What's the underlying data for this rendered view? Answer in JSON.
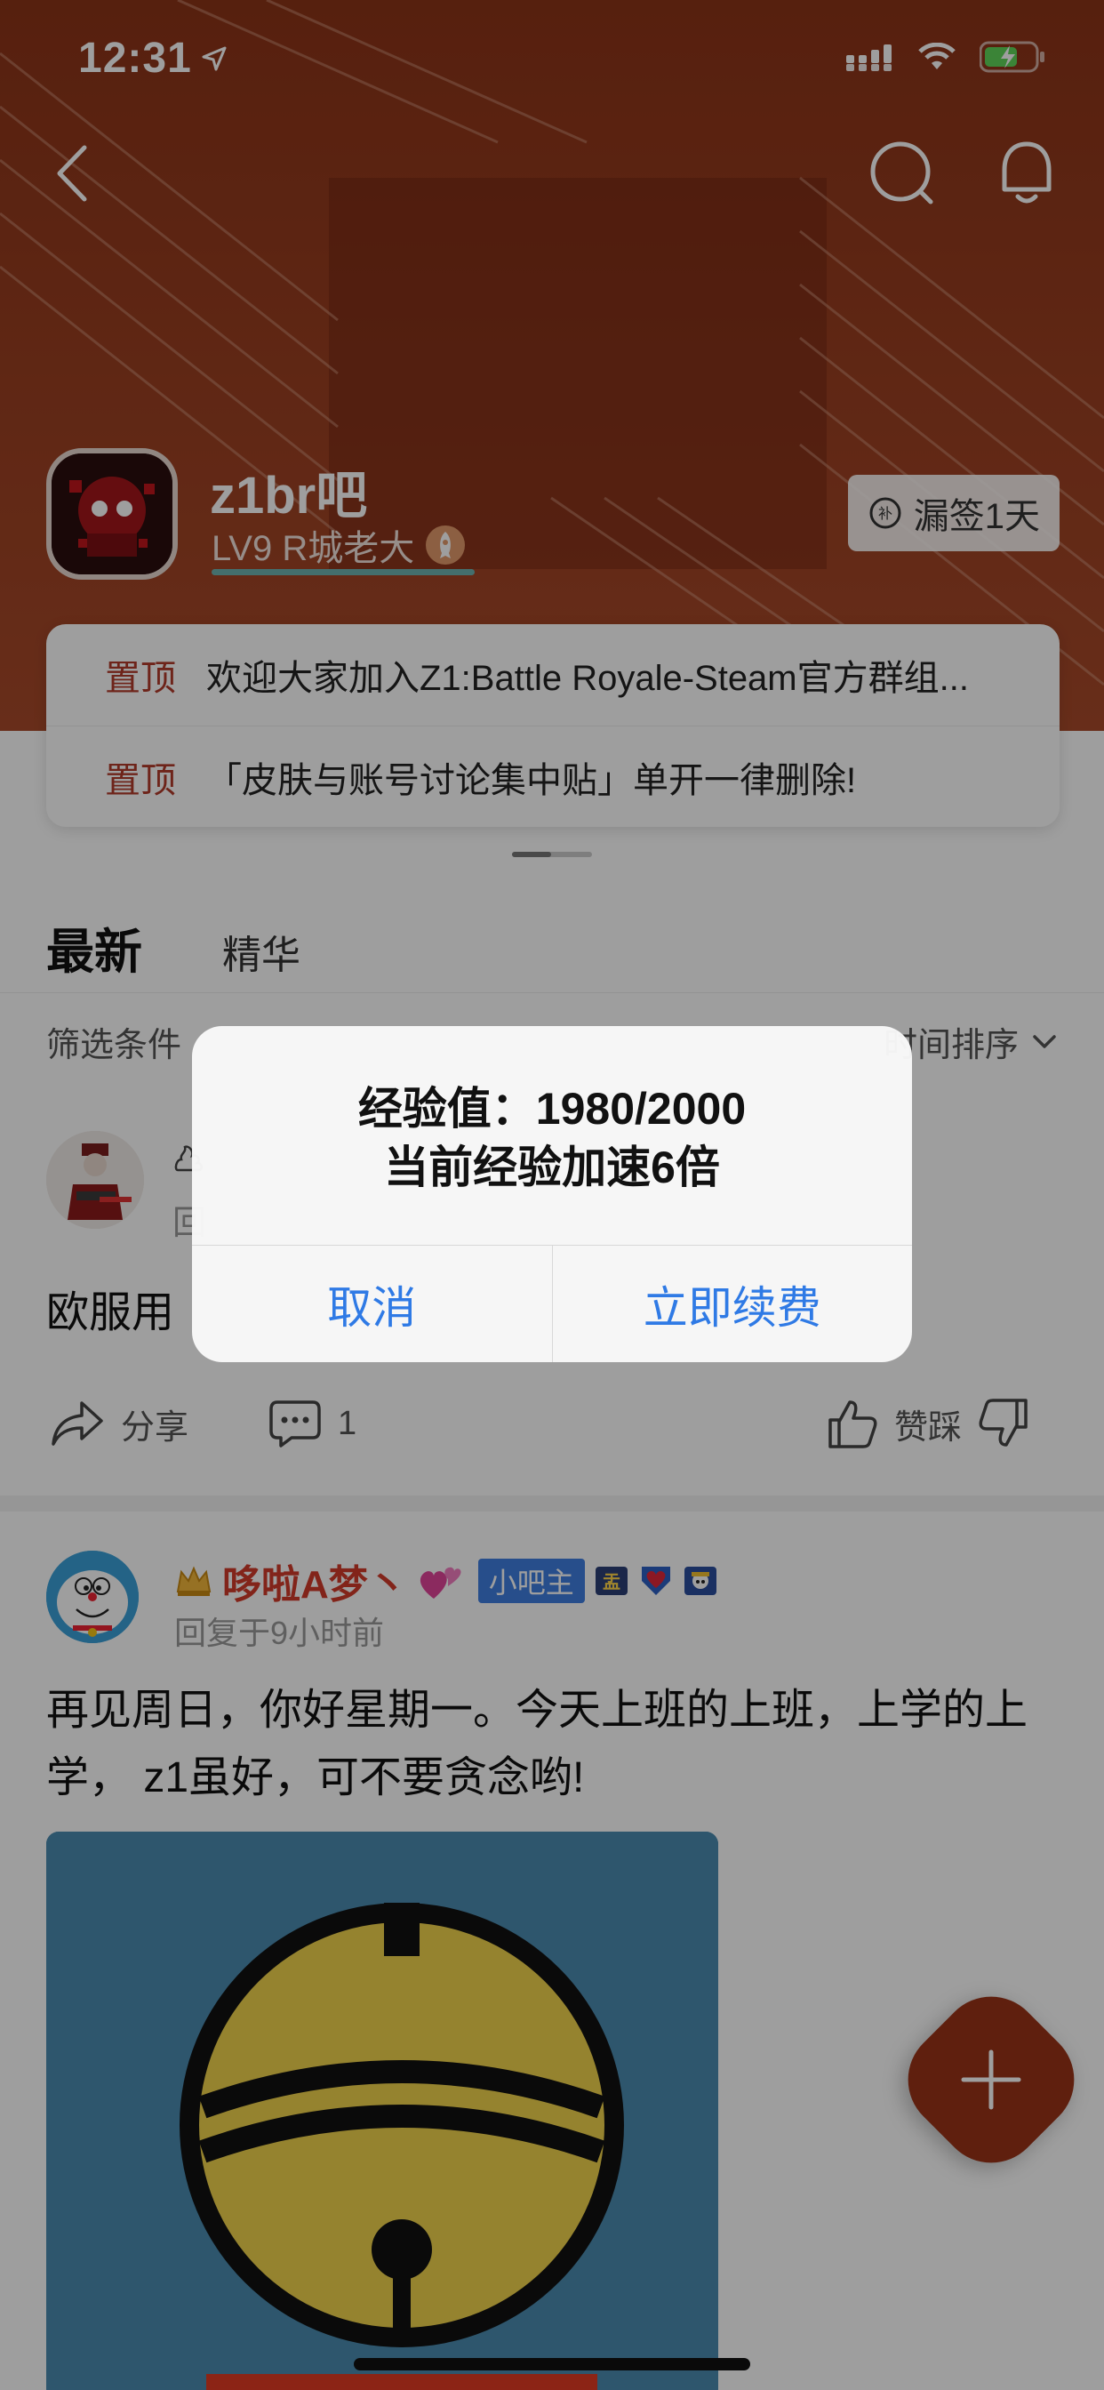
{
  "status_bar": {
    "time": "12:31"
  },
  "colors": {
    "banner": "#8a2f14",
    "accent_red": "#b23a2a",
    "link_blue": "#2f7ae5",
    "owner_badge": "#3f7ee0"
  },
  "forum": {
    "name": "z1br吧",
    "level": "LV9 R城老大",
    "sign_in_label": "漏签1天"
  },
  "pinned": [
    {
      "tag": "置顶",
      "text": "欢迎大家加入Z1:Battle Royale-Steam官方群组..."
    },
    {
      "tag": "置顶",
      "text": "「皮肤与账号讨论集中贴」单开一律删除!"
    }
  ],
  "tabs": [
    {
      "label": "最新"
    },
    {
      "label": "精华"
    }
  ],
  "filter": {
    "left": "筛选条件",
    "right": "时间排序"
  },
  "post1": {
    "text": "欧服用",
    "sub": "回",
    "share_label": "分享",
    "comment_count": "1",
    "vote_label": "赞踩"
  },
  "post2": {
    "author": "哆啦A梦丶",
    "owner_badge": "小吧主",
    "time": "回复于9小时前",
    "text": "再见周日，你好星期一。今天上班的上班，上学的上学， z1虽好，可不要贪念哟!"
  },
  "dialog": {
    "line1": "经验值：1980/2000",
    "line2": "当前经验加速6倍",
    "cancel": "取消",
    "confirm": "立即续费"
  },
  "icons": [
    "location-arrow-icon",
    "signal-icon",
    "wifi-icon",
    "battery-icon",
    "back-icon",
    "search-icon",
    "bell-icon",
    "rocket-icon",
    "sign-in-icon",
    "chevron-down-icon",
    "share-icon",
    "comment-icon",
    "thumbs-up-icon",
    "thumbs-down-icon",
    "crown-icon",
    "heart-icon",
    "plus-icon"
  ]
}
